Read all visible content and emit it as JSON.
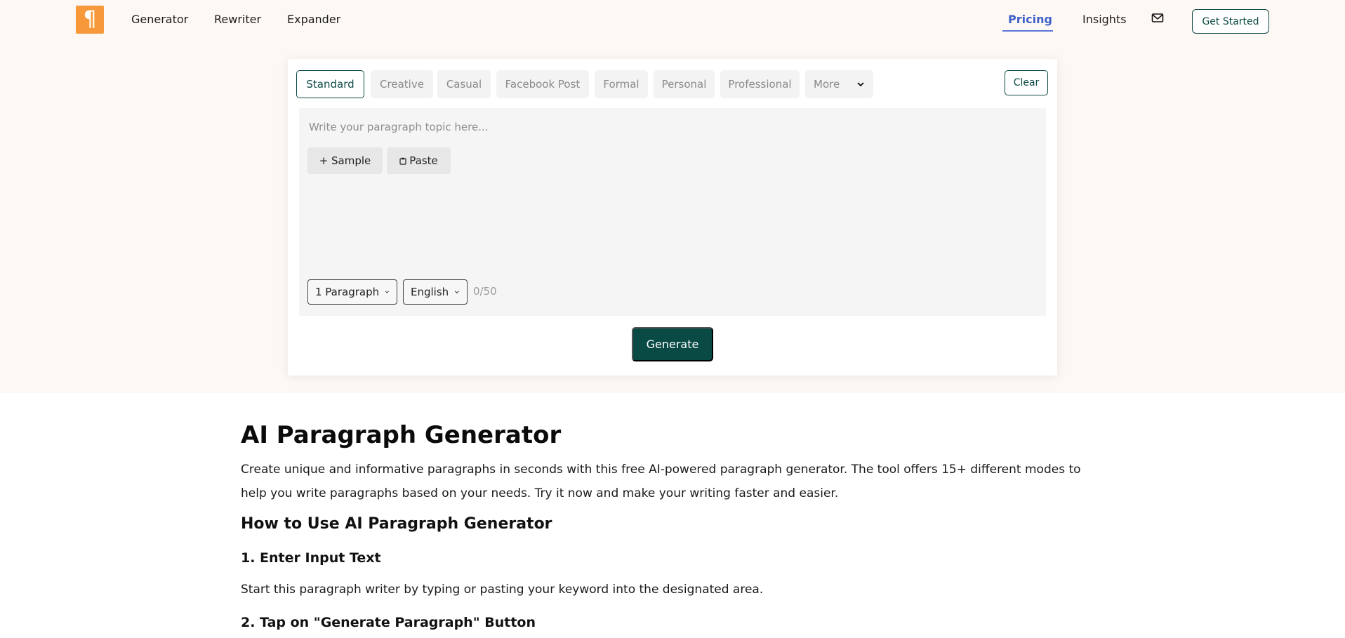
{
  "header": {
    "logo_glyph": "¶",
    "nav_left": [
      "Generator",
      "Rewriter",
      "Expander"
    ],
    "nav_right": [
      "Pricing",
      "Insights"
    ],
    "active_nav": "Pricing",
    "get_started": "Get Started"
  },
  "card": {
    "tabs": [
      "Standard",
      "Creative",
      "Casual",
      "Facebook Post",
      "Formal",
      "Personal",
      "Professional",
      "More"
    ],
    "active_tab": "Standard",
    "clear": "Clear",
    "placeholder": "Write your paragraph topic here...",
    "sample_button": "+ Sample",
    "paste_button": "Paste",
    "paragraph_select": "1 Paragraph",
    "language_select": "English",
    "counter": "0/50",
    "generate": "Generate"
  },
  "article": {
    "title": "AI Paragraph Generator",
    "intro": "Create unique and informative paragraphs in seconds with this free AI-powered paragraph generator. The tool offers 15+ different modes to help you write paragraphs based on your needs. Try it now and make your writing faster and easier.",
    "how_to_heading": "How to Use AI Paragraph Generator",
    "step1_heading": "1. Enter Input Text",
    "step1_text": "Start this paragraph writer by typing or pasting your keyword into the designated area.",
    "step2_heading": "2. Tap on \"Generate Paragraph\" Button"
  },
  "colors": {
    "brand_orange": "#f7993a",
    "primary_green": "#0a4a44",
    "link_blue": "#3f5fc9",
    "band_bg": "#fdf8f4"
  },
  "icons": [
    "pilcrow-logo-icon",
    "mail-icon",
    "chevron-down-icon",
    "clipboard-icon"
  ]
}
